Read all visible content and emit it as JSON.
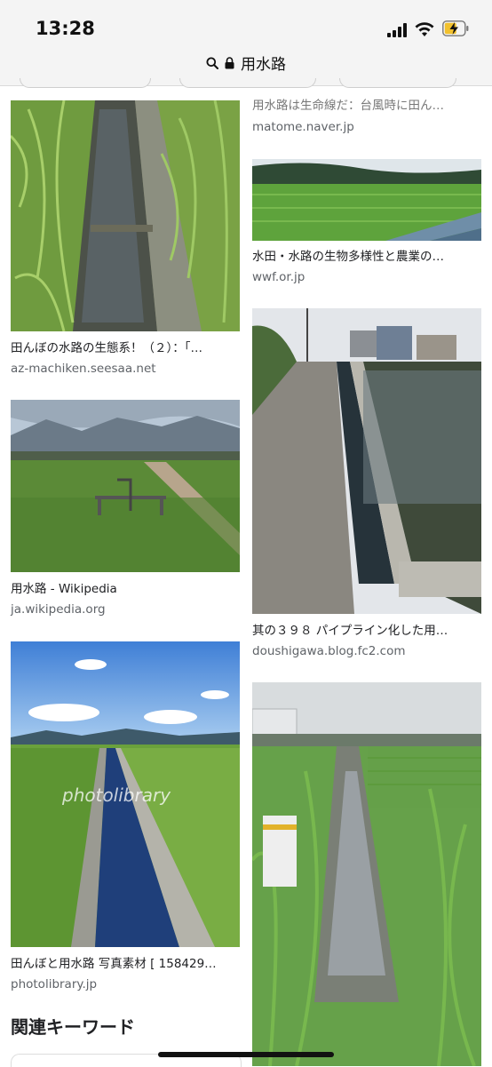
{
  "status_bar": {
    "time": "13:28"
  },
  "url_bar": {
    "query": "用水路"
  },
  "results": [
    {
      "title": "用水路は生命線だ：台風時に田ん…",
      "domain": "matome.naver.jp"
    },
    {
      "title": "田んぼの水路の生態系！（２）：「…",
      "domain": "az-machiken.seesaa.net"
    },
    {
      "title": "水田・水路の生物多様性と農業の…",
      "domain": "wwf.or.jp"
    },
    {
      "title": "用水路 - Wikipedia",
      "domain": "ja.wikipedia.org"
    },
    {
      "title": "其の３９８ パイプライン化した用…",
      "domain": "doushigawa.blog.fc2.com"
    },
    {
      "title": "田んぼと用水路 写真素材 [ 158429…",
      "domain": "photolibrary.jp",
      "watermark": "photolibrary"
    }
  ],
  "related_keywords": {
    "title": "関連キーワード"
  },
  "colors": {
    "sky": "#8fb7e6",
    "grass": "#5f9a3a",
    "water": "#3a4a57",
    "link_gray": "#5f6368"
  }
}
